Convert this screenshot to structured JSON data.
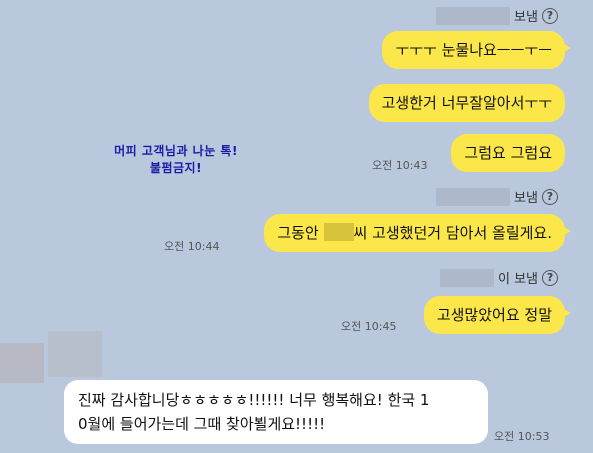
{
  "sender_label": "보냄",
  "sender_label_alt": "이 보냄",
  "help_glyph": "?",
  "watermark": {
    "line1": "머피 고객님과 나눈 톡!",
    "line2": "불펌금지!"
  },
  "messages": [
    {
      "text": "ㅜㅜㅜ 눈물나요ㅡㅡㅜㅡ"
    },
    {
      "text": "고생한거 너무잘알아서ㅜㅜ"
    },
    {
      "text": "그럼요 그럼요",
      "time": "오전 10:43"
    },
    {
      "text_before": "그동안",
      "text_after": "씨 고생했던거 담아서 올릴게요.",
      "time": "오전 10:44"
    },
    {
      "text": "고생많았어요 정말",
      "time": "오전 10:45"
    }
  ],
  "reply": {
    "line1": "진짜 감사합니당ㅎㅎㅎㅎㅎ!!!!!! 너무 행복해요! 한국 1",
    "line2": "0월에 들어가는데 그때 찾아뵐게요!!!!!",
    "time": "오전 10:53"
  },
  "colors": {
    "background": "#b9c8dc",
    "bubble_yellow": "#fbe74a",
    "bubble_white": "#ffffff",
    "watermark_blue": "#1a1aa8"
  }
}
